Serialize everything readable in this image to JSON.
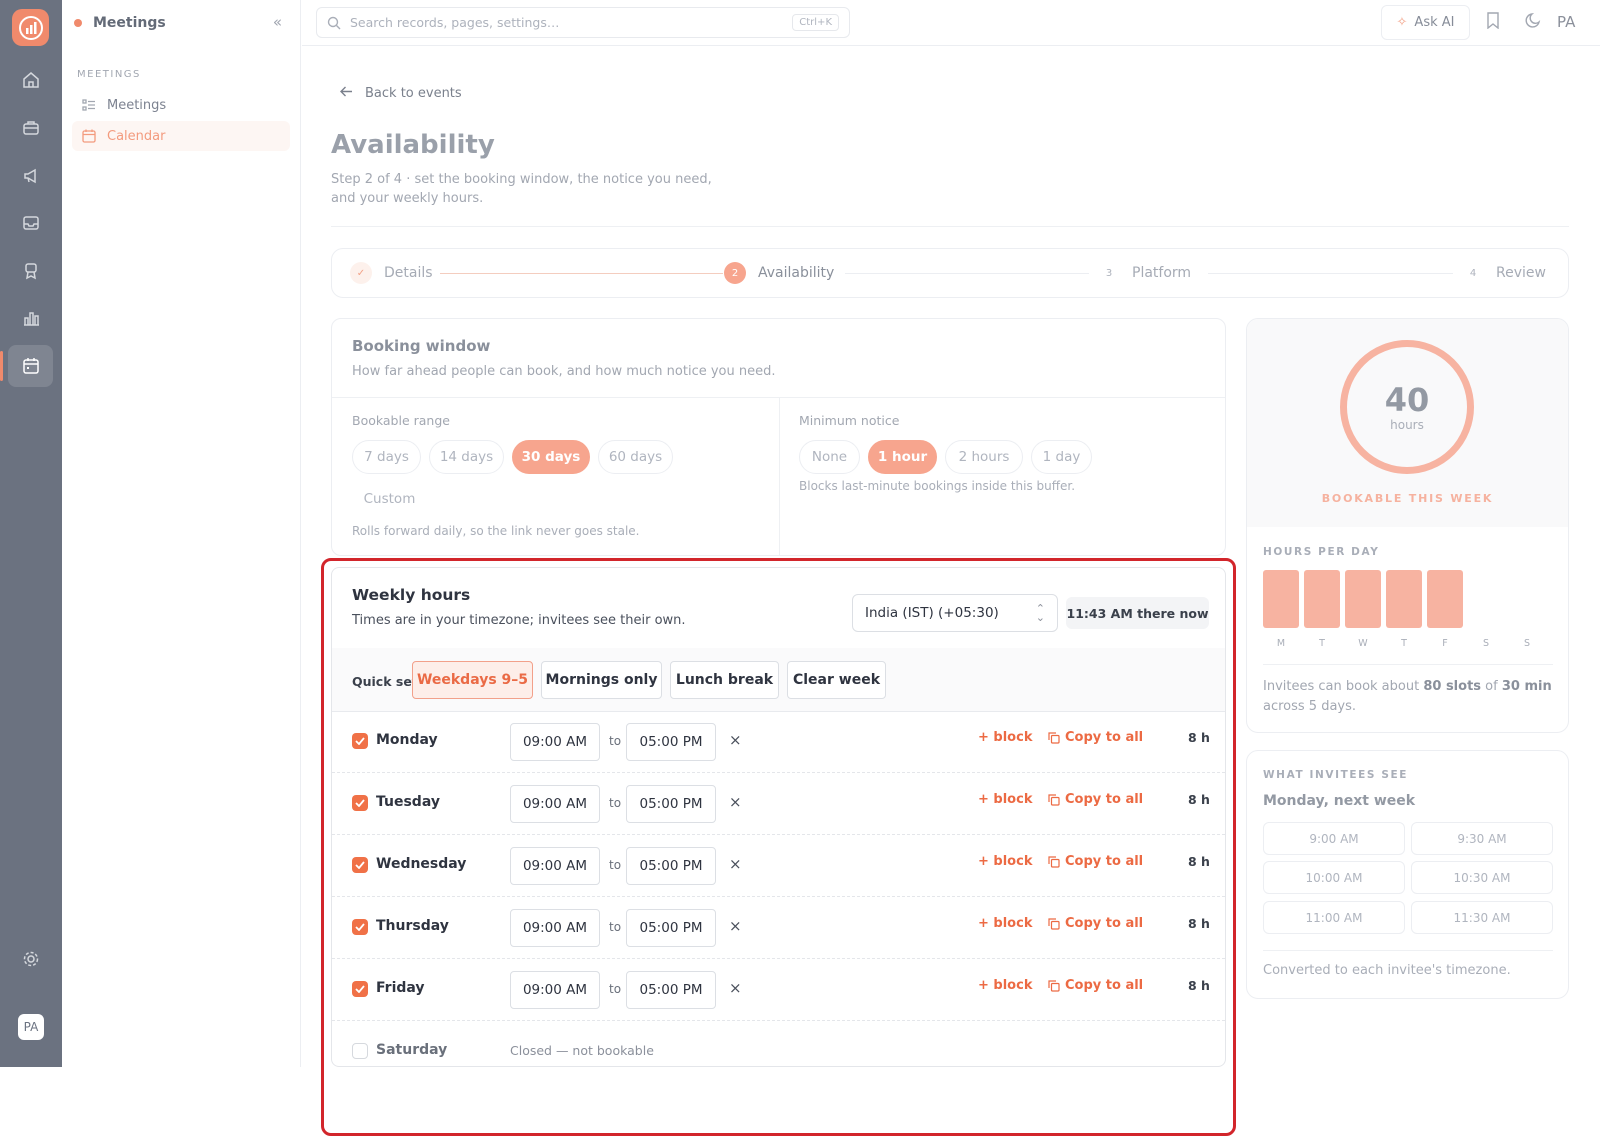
{
  "topbar": {
    "search_placeholder": "Search records, pages, settings…",
    "search_shortcut": "Ctrl+K",
    "ask_ai": "Ask AI",
    "avatar": "PA"
  },
  "rail": {
    "avatar": "PA"
  },
  "sidebar": {
    "app_title": "Meetings",
    "section": "MEETINGS",
    "items": [
      {
        "label": "Meetings",
        "icon": "list-icon",
        "active": false
      },
      {
        "label": "Calendar",
        "icon": "calendar-icon",
        "active": true
      }
    ]
  },
  "page": {
    "back": "Back to events",
    "title": "Availability",
    "subtitle": "Step 2 of 4 · set the booking window, the notice you need, and your weekly hours."
  },
  "stepper": {
    "steps": [
      {
        "num": "✓",
        "label": "Details",
        "state": "done"
      },
      {
        "num": "2",
        "label": "Availability",
        "state": "current"
      },
      {
        "num": "3",
        "label": "Platform",
        "state": "todo"
      },
      {
        "num": "4",
        "label": "Review",
        "state": "todo"
      }
    ]
  },
  "booking_window": {
    "title": "Booking window",
    "subtitle": "How far ahead people can book, and how much notice you need.",
    "range_label": "Bookable range",
    "range_options": [
      "7 days",
      "14 days",
      "30 days",
      "60 days",
      "Custom"
    ],
    "range_selected": "30 days",
    "range_note": "Rolls forward daily, so the link never goes stale.",
    "notice_label": "Minimum notice",
    "notice_options": [
      "None",
      "1 hour",
      "2 hours",
      "1 day"
    ],
    "notice_selected": "1 hour",
    "notice_note": "Blocks last-minute bookings inside this buffer."
  },
  "weekly_hours": {
    "title": "Weekly hours",
    "subtitle": "Times are in your timezone; invitees see their own.",
    "timezone": "India (IST) (+05:30)",
    "now": "11:43 AM there now",
    "quick_set_label": "Quick set",
    "quick_set": [
      "Weekdays 9–5",
      "Mornings only",
      "Lunch break",
      "Clear week"
    ],
    "quick_set_selected": "Weekdays 9–5",
    "to_label": "to",
    "block_label": "+ block",
    "copy_label": "Copy to all",
    "days": [
      {
        "day": "Monday",
        "enabled": true,
        "start": "09:00 AM",
        "end": "05:00 PM",
        "hours": "8 h"
      },
      {
        "day": "Tuesday",
        "enabled": true,
        "start": "09:00 AM",
        "end": "05:00 PM",
        "hours": "8 h"
      },
      {
        "day": "Wednesday",
        "enabled": true,
        "start": "09:00 AM",
        "end": "05:00 PM",
        "hours": "8 h"
      },
      {
        "day": "Thursday",
        "enabled": true,
        "start": "09:00 AM",
        "end": "05:00 PM",
        "hours": "8 h"
      },
      {
        "day": "Friday",
        "enabled": true,
        "start": "09:00 AM",
        "end": "05:00 PM",
        "hours": "8 h"
      },
      {
        "day": "Saturday",
        "enabled": false,
        "closed": "Closed — not bookable"
      }
    ]
  },
  "stats": {
    "hours_total": "40",
    "hours_unit": "hours",
    "bookable_caption": "BOOKABLE THIS WEEK",
    "per_day_title": "HOURS PER DAY",
    "per_day": [
      {
        "d": "M",
        "h": 8
      },
      {
        "d": "T",
        "h": 8
      },
      {
        "d": "W",
        "h": 8
      },
      {
        "d": "T",
        "h": 8
      },
      {
        "d": "F",
        "h": 8
      },
      {
        "d": "S",
        "h": 0
      },
      {
        "d": "S",
        "h": 0
      }
    ],
    "summary_pre": "Invitees can book about ",
    "summary_slots": "80 slots",
    "summary_mid": " of ",
    "summary_len": "30 min",
    "summary_post": " across 5 days.",
    "colors": {
      "accent": "#f07147",
      "bar": "#f7b3a1"
    }
  },
  "invitees": {
    "title": "WHAT INVITEES SEE",
    "date": "Monday, next week",
    "slots": [
      "9:00 AM",
      "9:30 AM",
      "10:00 AM",
      "10:30 AM",
      "11:00 AM",
      "11:30 AM"
    ],
    "footer": "Converted to each invitee's timezone."
  }
}
